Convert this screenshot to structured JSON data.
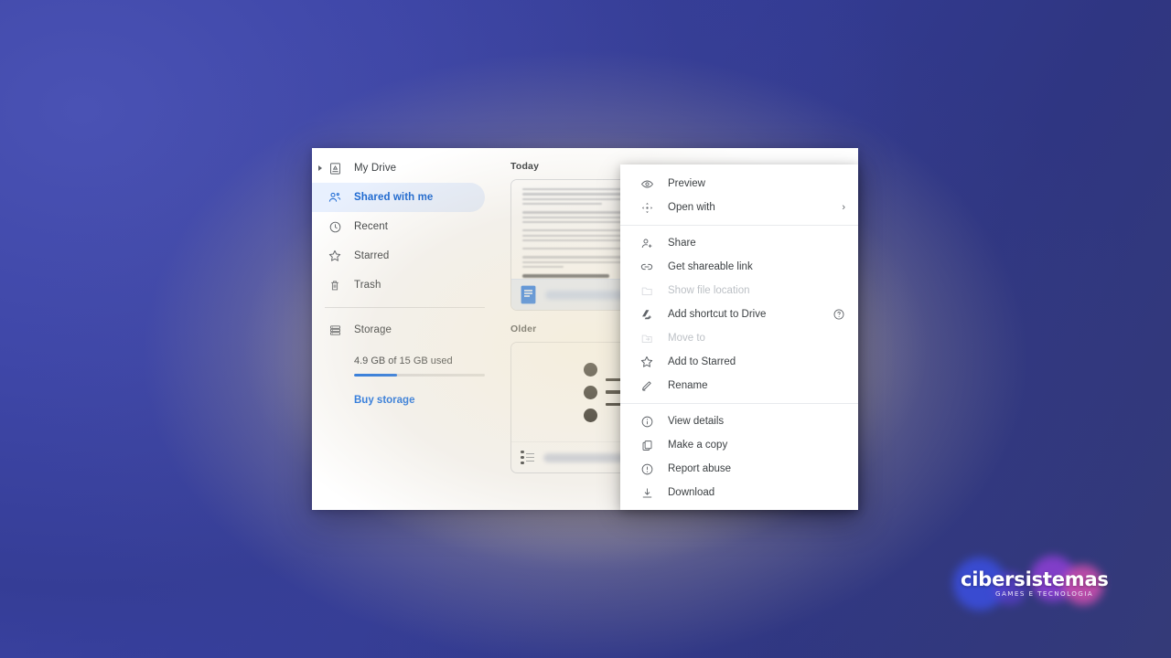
{
  "desktop": {
    "background_colors": {
      "blue_primary": "#3f47a8",
      "blue_dark": "#2f3682",
      "glow_warm": "#e2d3b0"
    }
  },
  "sidebar": {
    "items": [
      {
        "label": "My Drive",
        "icon": "my-drive-icon",
        "active": false,
        "has_caret": true
      },
      {
        "label": "Shared with me",
        "icon": "shared-with-me-icon",
        "active": true,
        "has_caret": false
      },
      {
        "label": "Recent",
        "icon": "clock-icon",
        "active": false,
        "has_caret": false
      },
      {
        "label": "Starred",
        "icon": "star-icon",
        "active": false,
        "has_caret": false
      },
      {
        "label": "Trash",
        "icon": "trash-icon",
        "active": false,
        "has_caret": false
      }
    ],
    "storage": {
      "label": "Storage",
      "icon": "storage-icon",
      "usage_text": "4.9 GB of 15 GB used",
      "used_percent": 33,
      "bar_color": "#1a73e8",
      "buy_link": "Buy storage",
      "link_color": "#1a73e8"
    },
    "active_item_bg": "#e8f0fe",
    "active_item_color": "#1967d2"
  },
  "files": {
    "sections": [
      {
        "title": "Today"
      },
      {
        "title": "Older"
      }
    ],
    "today_card": {
      "file_icon": "google-docs-icon",
      "selected": true,
      "thumbnail_type": "document-text",
      "name_blurred": true
    },
    "older_card": {
      "file_icon": "bulleted-list-icon",
      "selected": false,
      "thumbnail_type": "bulleted-list-graphic",
      "name_blurred": true
    }
  },
  "context_menu": {
    "groups": [
      {
        "items": [
          {
            "label": "Preview",
            "icon": "eye-icon",
            "disabled": false,
            "submenu": false,
            "help": false
          },
          {
            "label": "Open with",
            "icon": "open-with-icon",
            "disabled": false,
            "submenu": true,
            "help": false
          }
        ]
      },
      {
        "items": [
          {
            "label": "Share",
            "icon": "person-add-icon",
            "disabled": false,
            "submenu": false,
            "help": false
          },
          {
            "label": "Get shareable link",
            "icon": "link-icon",
            "disabled": false,
            "submenu": false,
            "help": false
          },
          {
            "label": "Show file location",
            "icon": "folder-icon",
            "disabled": true,
            "submenu": false,
            "help": false
          },
          {
            "label": "Add shortcut to Drive",
            "icon": "drive-add-icon",
            "disabled": false,
            "submenu": false,
            "help": true
          },
          {
            "label": "Move to",
            "icon": "move-to-icon",
            "disabled": true,
            "submenu": false,
            "help": false
          },
          {
            "label": "Add to Starred",
            "icon": "star-icon",
            "disabled": false,
            "submenu": false,
            "help": false
          },
          {
            "label": "Rename",
            "icon": "pencil-icon",
            "disabled": false,
            "submenu": false,
            "help": false
          }
        ]
      },
      {
        "items": [
          {
            "label": "View details",
            "icon": "info-icon",
            "disabled": false,
            "submenu": false,
            "help": false
          },
          {
            "label": "Make a copy",
            "icon": "copy-icon",
            "disabled": false,
            "submenu": false,
            "help": false
          },
          {
            "label": "Report abuse",
            "icon": "alert-icon",
            "disabled": false,
            "submenu": false,
            "help": false
          },
          {
            "label": "Download",
            "icon": "download-icon",
            "disabled": false,
            "submenu": false,
            "help": false
          }
        ]
      }
    ],
    "submenu_glyph": "›"
  },
  "watermark": {
    "text": "cibersistemas",
    "subtitle": "GAMES E TECNOLOGIA"
  }
}
